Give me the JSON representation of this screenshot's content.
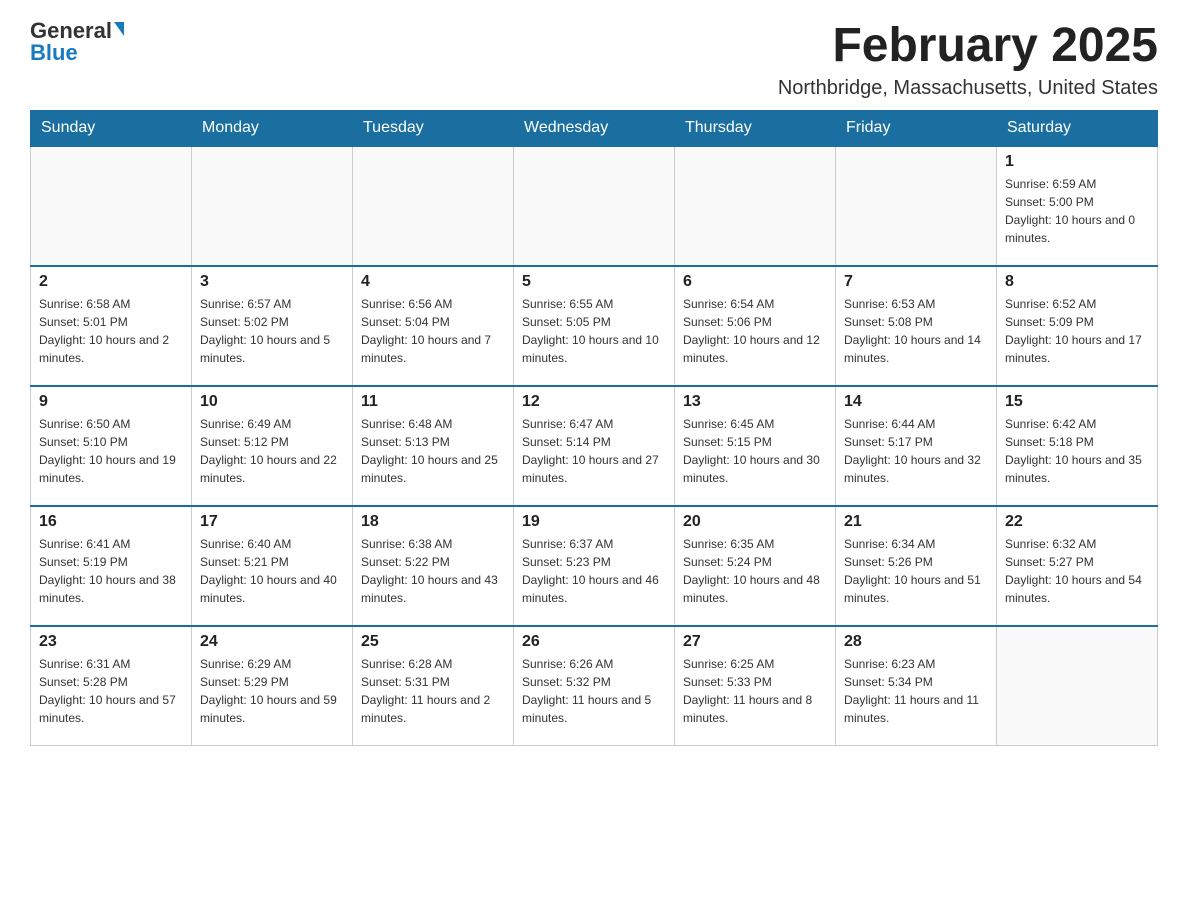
{
  "header": {
    "logo_general": "General",
    "logo_blue": "Blue",
    "month_title": "February 2025",
    "location": "Northbridge, Massachusetts, United States"
  },
  "days_of_week": [
    "Sunday",
    "Monday",
    "Tuesday",
    "Wednesday",
    "Thursday",
    "Friday",
    "Saturday"
  ],
  "weeks": [
    [
      {
        "day": "",
        "info": ""
      },
      {
        "day": "",
        "info": ""
      },
      {
        "day": "",
        "info": ""
      },
      {
        "day": "",
        "info": ""
      },
      {
        "day": "",
        "info": ""
      },
      {
        "day": "",
        "info": ""
      },
      {
        "day": "1",
        "info": "Sunrise: 6:59 AM\nSunset: 5:00 PM\nDaylight: 10 hours and 0 minutes."
      }
    ],
    [
      {
        "day": "2",
        "info": "Sunrise: 6:58 AM\nSunset: 5:01 PM\nDaylight: 10 hours and 2 minutes."
      },
      {
        "day": "3",
        "info": "Sunrise: 6:57 AM\nSunset: 5:02 PM\nDaylight: 10 hours and 5 minutes."
      },
      {
        "day": "4",
        "info": "Sunrise: 6:56 AM\nSunset: 5:04 PM\nDaylight: 10 hours and 7 minutes."
      },
      {
        "day": "5",
        "info": "Sunrise: 6:55 AM\nSunset: 5:05 PM\nDaylight: 10 hours and 10 minutes."
      },
      {
        "day": "6",
        "info": "Sunrise: 6:54 AM\nSunset: 5:06 PM\nDaylight: 10 hours and 12 minutes."
      },
      {
        "day": "7",
        "info": "Sunrise: 6:53 AM\nSunset: 5:08 PM\nDaylight: 10 hours and 14 minutes."
      },
      {
        "day": "8",
        "info": "Sunrise: 6:52 AM\nSunset: 5:09 PM\nDaylight: 10 hours and 17 minutes."
      }
    ],
    [
      {
        "day": "9",
        "info": "Sunrise: 6:50 AM\nSunset: 5:10 PM\nDaylight: 10 hours and 19 minutes."
      },
      {
        "day": "10",
        "info": "Sunrise: 6:49 AM\nSunset: 5:12 PM\nDaylight: 10 hours and 22 minutes."
      },
      {
        "day": "11",
        "info": "Sunrise: 6:48 AM\nSunset: 5:13 PM\nDaylight: 10 hours and 25 minutes."
      },
      {
        "day": "12",
        "info": "Sunrise: 6:47 AM\nSunset: 5:14 PM\nDaylight: 10 hours and 27 minutes."
      },
      {
        "day": "13",
        "info": "Sunrise: 6:45 AM\nSunset: 5:15 PM\nDaylight: 10 hours and 30 minutes."
      },
      {
        "day": "14",
        "info": "Sunrise: 6:44 AM\nSunset: 5:17 PM\nDaylight: 10 hours and 32 minutes."
      },
      {
        "day": "15",
        "info": "Sunrise: 6:42 AM\nSunset: 5:18 PM\nDaylight: 10 hours and 35 minutes."
      }
    ],
    [
      {
        "day": "16",
        "info": "Sunrise: 6:41 AM\nSunset: 5:19 PM\nDaylight: 10 hours and 38 minutes."
      },
      {
        "day": "17",
        "info": "Sunrise: 6:40 AM\nSunset: 5:21 PM\nDaylight: 10 hours and 40 minutes."
      },
      {
        "day": "18",
        "info": "Sunrise: 6:38 AM\nSunset: 5:22 PM\nDaylight: 10 hours and 43 minutes."
      },
      {
        "day": "19",
        "info": "Sunrise: 6:37 AM\nSunset: 5:23 PM\nDaylight: 10 hours and 46 minutes."
      },
      {
        "day": "20",
        "info": "Sunrise: 6:35 AM\nSunset: 5:24 PM\nDaylight: 10 hours and 48 minutes."
      },
      {
        "day": "21",
        "info": "Sunrise: 6:34 AM\nSunset: 5:26 PM\nDaylight: 10 hours and 51 minutes."
      },
      {
        "day": "22",
        "info": "Sunrise: 6:32 AM\nSunset: 5:27 PM\nDaylight: 10 hours and 54 minutes."
      }
    ],
    [
      {
        "day": "23",
        "info": "Sunrise: 6:31 AM\nSunset: 5:28 PM\nDaylight: 10 hours and 57 minutes."
      },
      {
        "day": "24",
        "info": "Sunrise: 6:29 AM\nSunset: 5:29 PM\nDaylight: 10 hours and 59 minutes."
      },
      {
        "day": "25",
        "info": "Sunrise: 6:28 AM\nSunset: 5:31 PM\nDaylight: 11 hours and 2 minutes."
      },
      {
        "day": "26",
        "info": "Sunrise: 6:26 AM\nSunset: 5:32 PM\nDaylight: 11 hours and 5 minutes."
      },
      {
        "day": "27",
        "info": "Sunrise: 6:25 AM\nSunset: 5:33 PM\nDaylight: 11 hours and 8 minutes."
      },
      {
        "day": "28",
        "info": "Sunrise: 6:23 AM\nSunset: 5:34 PM\nDaylight: 11 hours and 11 minutes."
      },
      {
        "day": "",
        "info": ""
      }
    ]
  ]
}
